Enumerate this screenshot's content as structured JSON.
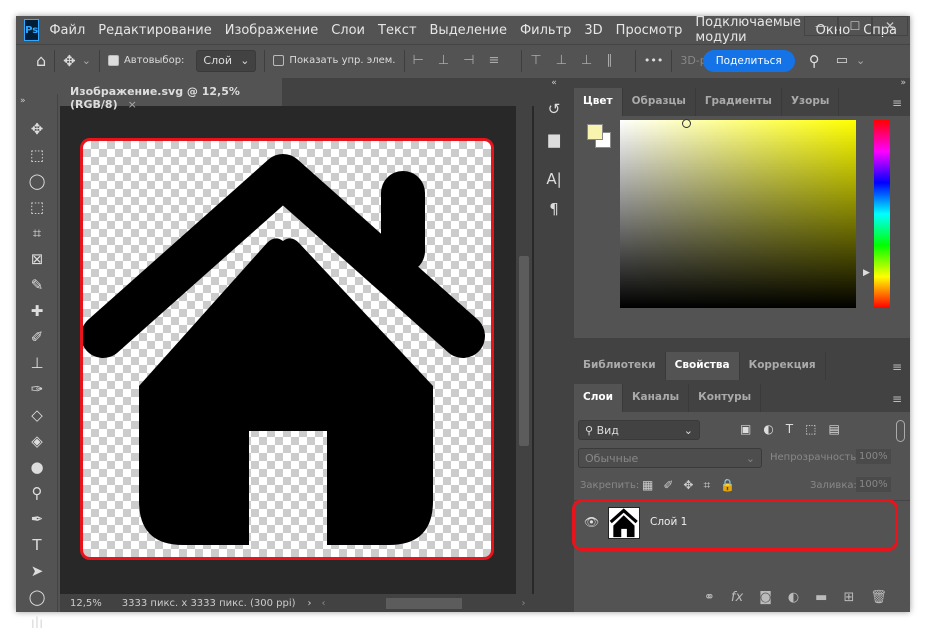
{
  "app": {
    "logo": "Ps",
    "menu": [
      "Файл",
      "Редактирование",
      "Изображение",
      "Слои",
      "Текст",
      "Выделение",
      "Фильтр",
      "3D",
      "Просмотр",
      "Подключаемые модули",
      "Окно",
      "Спра"
    ]
  },
  "options": {
    "autoselect_label": "Автовыбор:",
    "autoselect_checked": true,
    "autoselect_value": "Слой",
    "show_controls_label": "Показать упр. элем.",
    "show_controls_checked": false,
    "more": "•••",
    "mode_3d": "3D-р",
    "share": "Поделиться"
  },
  "document": {
    "tab_title": "Изображение.svg @ 12,5% (RGB/8)",
    "zoom": "12,5%",
    "info": "3333 пикс. x 3333 пикс. (300 ppi)"
  },
  "color_panel": {
    "tabs": [
      "Цвет",
      "Образцы",
      "Градиенты",
      "Узоры"
    ],
    "active": "Цвет",
    "foreground": "#f8f4b0",
    "background": "#ffffff",
    "hue": "#ffff00"
  },
  "properties_panel": {
    "tabs": [
      "Библиотеки",
      "Свойства",
      "Коррекция"
    ],
    "active": "Свойства"
  },
  "layers_panel": {
    "tabs": [
      "Слои",
      "Каналы",
      "Контуры"
    ],
    "active": "Слои",
    "filter": "Вид",
    "blend_mode": "Обычные",
    "opacity_label": "Непрозрачность:",
    "opacity": "100%",
    "lock_label": "Закрепить:",
    "fill_label": "Заливка:",
    "fill": "100%",
    "layers": [
      {
        "name": "Слой 1",
        "visible": true
      }
    ]
  },
  "accent": "#1473e6",
  "highlight": "#e8131b"
}
